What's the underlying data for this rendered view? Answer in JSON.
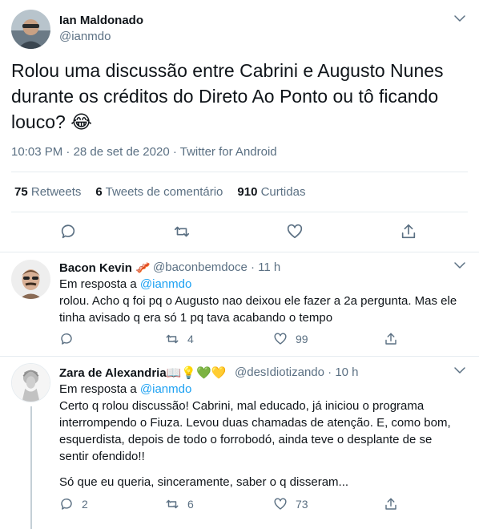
{
  "author": {
    "name": "Ian Maldonado",
    "handle": "@ianmdo"
  },
  "tweet": {
    "lines": [
      "Rolou uma discussão entre Cabrini e Augusto Nunes",
      "durante os créditos do Direto Ao Ponto ou tô ficando",
      "louco? 😂"
    ],
    "time": "10:03 PM",
    "date": "28 de set de 2020",
    "source": "Twitter for Android"
  },
  "stats": {
    "retweets_count": "75",
    "retweets_label": "Retweets",
    "quotes_count": "6",
    "quotes_label": "Tweets de comentário",
    "likes_count": "910",
    "likes_label": "Curtidas"
  },
  "replies": [
    {
      "name": "Bacon Kevin 🥓",
      "handle": "@baconbemdoce",
      "age": "11 h",
      "reply_to_prefix": "Em resposta a",
      "reply_to": "@ianmdo",
      "lines": [
        "rolou. Acho q foi pq o Augusto nao deixou ele fazer a 2a pergunta. Mas ele",
        "tinha avisado q era só 1 pq tava acabando o tempo"
      ],
      "comments": "",
      "retweets": "4",
      "likes": "99"
    },
    {
      "name": "Zara de Alexandria📖💡💚💛",
      "handle": "@desIdiotizando",
      "age": "10 h",
      "reply_to_prefix": "Em resposta a",
      "reply_to": "@ianmdo",
      "lines": [
        "Certo q rolou discussão! Cabrini, mal educado, já iniciou o programa",
        "interrompendo o Fiuza. Levou duas chamadas de atenção. E, como bom,",
        "esquerdista, depois de todo o forrobodó, ainda teve o desplante de se",
        "sentir ofendido!!",
        "",
        "Só que eu queria, sinceramente, saber o q disseram..."
      ],
      "comments": "2",
      "retweets": "6",
      "likes": "73"
    }
  ],
  "icons": {
    "chevron": "chevron-down-icon",
    "reply": "comment-icon",
    "retweet": "retweet-icon",
    "like": "heart-icon",
    "share": "share-icon"
  },
  "colors": {
    "accent": "#1da1f2",
    "muted": "#5b7083",
    "text": "#0f1419",
    "divider": "#e6ecf0"
  }
}
